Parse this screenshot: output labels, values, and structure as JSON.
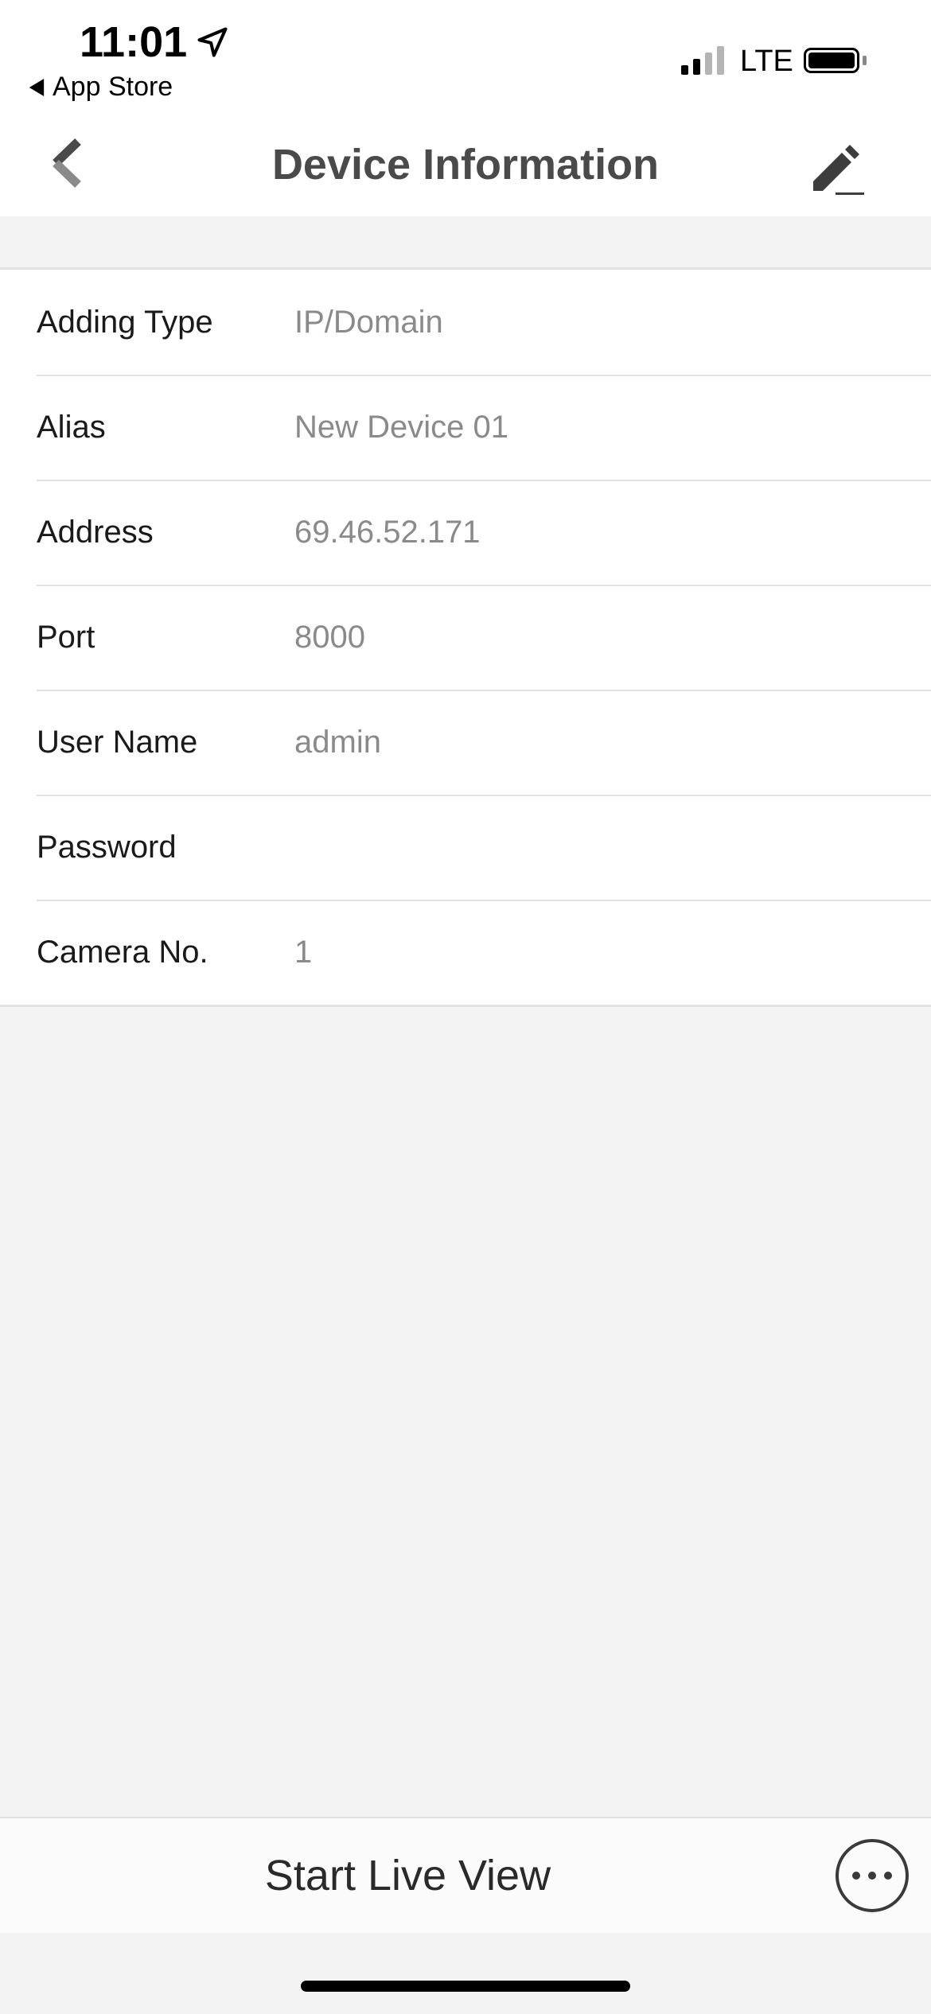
{
  "status_bar": {
    "time": "11:01",
    "back_app": "App Store",
    "network": "LTE"
  },
  "nav": {
    "title": "Device Information"
  },
  "fields": [
    {
      "label": "Adding Type",
      "value": "IP/Domain"
    },
    {
      "label": "Alias",
      "value": "New Device 01"
    },
    {
      "label": "Address",
      "value": "69.46.52.171"
    },
    {
      "label": "Port",
      "value": "8000"
    },
    {
      "label": "User Name",
      "value": "admin"
    },
    {
      "label": "Password",
      "value": ""
    },
    {
      "label": "Camera No.",
      "value": "1"
    }
  ],
  "bottom": {
    "live_view_label": "Start Live View"
  },
  "colors": {
    "background": "#f3f3f3",
    "title": "#4a4a4a",
    "value": "#8a8a8a"
  }
}
